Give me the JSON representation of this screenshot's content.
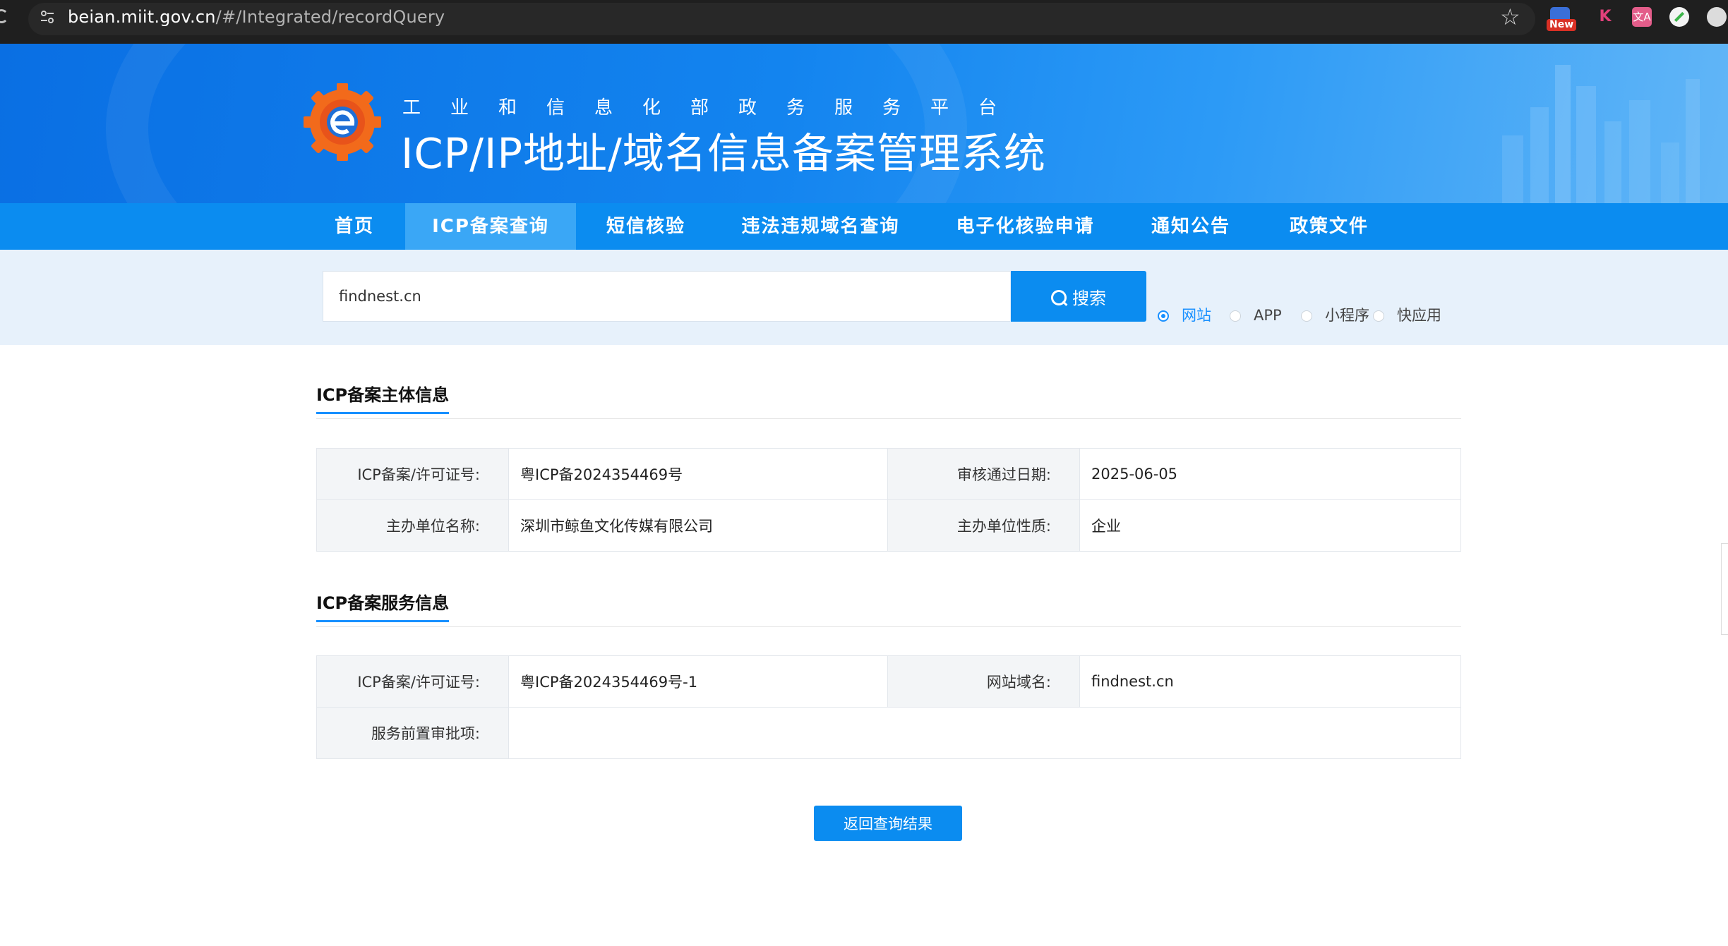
{
  "browser": {
    "url_host": "beian.miit.gov.cn",
    "url_path": "/#/Integrated/recordQuery",
    "extension_new_badge": "New",
    "extension_k": "K",
    "extension_translate": "文A"
  },
  "header": {
    "subtitle": "工业和信息化部政务服务平台",
    "title": "ICP/IP地址/域名信息备案管理系统"
  },
  "nav": {
    "items": [
      "首页",
      "ICP备案查询",
      "短信核验",
      "违法违规域名查询",
      "电子化核验申请",
      "通知公告",
      "政策文件"
    ],
    "active_index": 1
  },
  "search": {
    "value": "findnest.cn",
    "button_label": "搜索",
    "types": [
      "网站",
      "APP",
      "小程序",
      "快应用"
    ],
    "selected_type": "网站"
  },
  "subject_section": {
    "title": "ICP备案主体信息",
    "rows": [
      [
        "ICP备案/许可证号:",
        "粤ICP备2024354469号",
        "审核通过日期:",
        "2025-06-05"
      ],
      [
        "主办单位名称:",
        "深圳市鲸鱼文化传媒有限公司",
        "主办单位性质:",
        "企业"
      ]
    ]
  },
  "service_section": {
    "title": "ICP备案服务信息",
    "license_label": "ICP备案/许可证号:",
    "license_value": "粤ICP备2024354469号-1",
    "domain_label": "网站域名:",
    "domain_value": "findnest.cn",
    "approval_label": "服务前置审批项:",
    "approval_value": ""
  },
  "actions": {
    "back_label": "返回查询结果"
  },
  "colors": {
    "accent": "#0b8cf0",
    "nav_active": "#3aa7f6",
    "search_bg": "#e7f1fb",
    "radio_checked": "#1890ff"
  }
}
